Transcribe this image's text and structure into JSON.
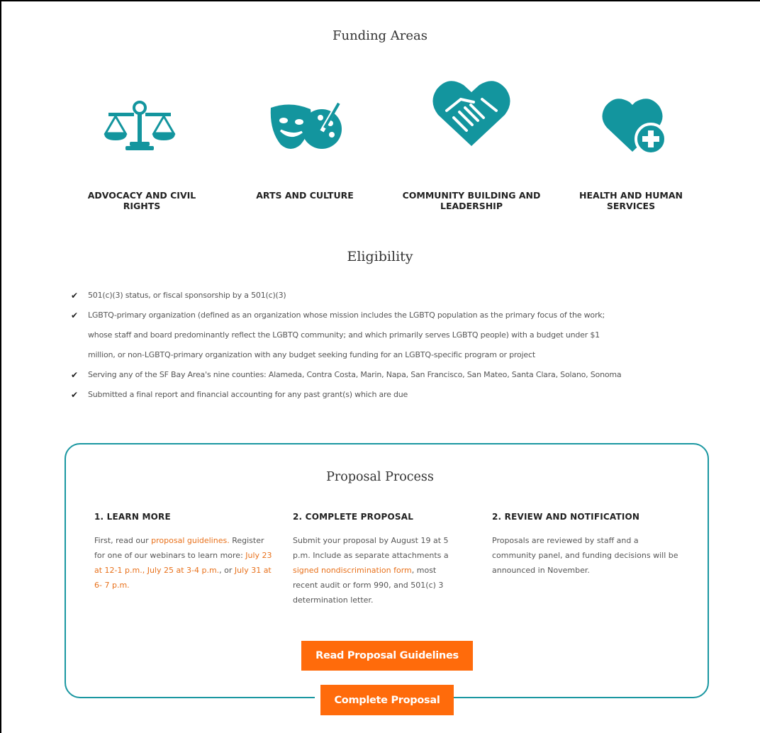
{
  "funding": {
    "title": "Funding Areas",
    "areas": [
      {
        "label_line1": "ADVOCACY AND CIVIL",
        "label_line2": "RIGHTS",
        "icon": "scales-icon"
      },
      {
        "label_line1": "ARTS AND CULTURE",
        "label_line2": "",
        "icon": "theater-masks-palette-icon"
      },
      {
        "label_line1": "COMMUNITY BUILDING AND",
        "label_line2": "LEADERSHIP",
        "icon": "heart-handshake-icon"
      },
      {
        "label_line1": "HEALTH AND HUMAN",
        "label_line2": "SERVICES",
        "icon": "heart-plus-icon"
      }
    ],
    "icon_color": "#13959e"
  },
  "eligibility": {
    "title": "Eligibility",
    "items": [
      "501(c)(3) status, or fiscal sponsorship by a 501(c)(3)",
      "LGBTQ-primary organization (defined as an organization whose mission includes the LGBTQ population as the primary focus of the work;",
      "whose staff and board predominantly reflect the LGBTQ community; and which primarily serves LGBTQ people) with a budget under $1",
      "million, or non-LGBTQ-primary organization with any budget seeking funding for an LGBTQ-specific program or project",
      "Serving any of the SF Bay Area's nine counties: Alameda, Contra Costa, Marin, Napa, San Francisco, San Mateo, Santa Clara, Solano, Sonoma",
      "Submitted a final report and financial accounting for any past grant(s) which are due"
    ]
  },
  "proposal": {
    "title": "Proposal Process",
    "border_color": "#1a97a1",
    "link_color": "#e8701a",
    "button_color": "#ff6b0b",
    "step1": {
      "heading": "1. LEARN MORE",
      "t1": "First, read our ",
      "link1": "proposal guidelines.",
      "t2": " Register for one of our webinars to learn more: ",
      "link2": "July 23 at 12-1 p.m., July 25 at 3-4 p.m.",
      "t3": ", or ",
      "link3": "July 31 at 6- 7 p.m."
    },
    "step2": {
      "heading": "2. COMPLETE PROPOSAL",
      "t1": "Submit your proposal by August 19 at 5 p.m. Include as separate attachments a ",
      "link1": "signed nondiscrimination form",
      "t2": ", most recent audit or form 990, and 501(c) 3 determination letter."
    },
    "step3": {
      "heading": "2. REVIEW AND NOTIFICATION",
      "text": "Proposals are reviewed by staff and a community panel, and funding decisions will be announced in November."
    },
    "buttons": {
      "guidelines": "Read Proposal Guidelines",
      "complete": "Complete Proposal"
    }
  }
}
